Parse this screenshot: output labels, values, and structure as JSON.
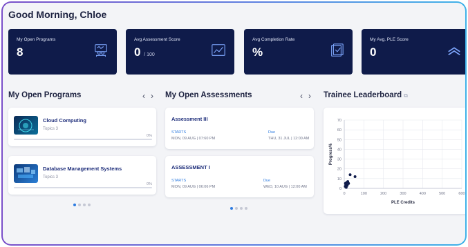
{
  "greeting": "Good Morning, Chloe",
  "stats": [
    {
      "title": "My Open Programs",
      "value": "8",
      "sub": "",
      "icon": "student-desk-icon"
    },
    {
      "title": "Avg Assessment Score",
      "value": "0",
      "sub": "/ 100",
      "icon": "line-chart-icon"
    },
    {
      "title": "Avg Completion Rate",
      "value": "%",
      "sub": "",
      "icon": "checklist-icon"
    },
    {
      "title": "My Avg. PLE Score",
      "value": "0",
      "sub": "",
      "icon": "double-chevron-up-icon"
    }
  ],
  "programs": {
    "title": "My Open Programs",
    "prev": "‹",
    "next": "›",
    "items": [
      {
        "name": "Cloud Computing",
        "topics": "Topics 3",
        "progress": "0%",
        "progress_value": 0
      },
      {
        "name": "Database Management Systems",
        "topics": "Topics 3",
        "progress": "0%",
        "progress_value": 0
      }
    ]
  },
  "assessments": {
    "title": "My Open Assessments",
    "prev": "‹",
    "next": "›",
    "items": [
      {
        "name": "Assessment III",
        "starts_label": "STARTS",
        "starts": "MON, 09 AUG | 07:60 PM",
        "due_label": "Due",
        "due": "THU, 31 JUL | 12:00 AM"
      },
      {
        "name": "ASSESSMENT I",
        "starts_label": "STARTS",
        "starts": "MON, 09 AUG | 06:06 PM",
        "due_label": "Due",
        "due": "WED, 10 AUG | 12:00 AM"
      }
    ]
  },
  "leaderboard": {
    "title": "Trainee Leaderboard",
    "ext_icon": "external-link-icon"
  },
  "chart_data": {
    "type": "scatter",
    "xlabel": "PLE Credits",
    "ylabel": "Progress%",
    "xlim": [
      0,
      600
    ],
    "ylim": [
      0,
      70
    ],
    "x_ticks": [
      "0",
      "100",
      "200",
      "300",
      "400",
      "500",
      "600"
    ],
    "y_ticks": [
      "0",
      "10",
      "20",
      "30",
      "40",
      "50",
      "60",
      "70"
    ],
    "grid": true,
    "points": [
      {
        "x": 5,
        "y": 2
      },
      {
        "x": 8,
        "y": 4
      },
      {
        "x": 12,
        "y": 6
      },
      {
        "x": 15,
        "y": 3
      },
      {
        "x": 18,
        "y": 7
      },
      {
        "x": 22,
        "y": 5
      },
      {
        "x": 10,
        "y": 1
      },
      {
        "x": 6,
        "y": 5
      },
      {
        "x": 30,
        "y": 14
      },
      {
        "x": 55,
        "y": 12
      }
    ]
  },
  "colors": {
    "card_bg": "#0f1b4a",
    "accent": "#2d7be0",
    "page_bg": "#f3f4f7"
  }
}
